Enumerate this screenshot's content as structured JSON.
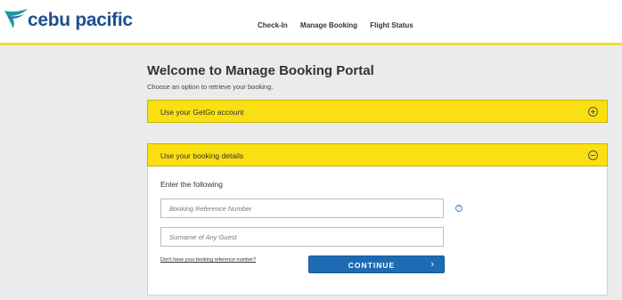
{
  "brand": {
    "name": "cebu pacific",
    "primary_color": "#1d4f8f",
    "accent_color": "#fadf12"
  },
  "nav": {
    "items": [
      "Check-In",
      "Manage Booking",
      "Flight Status"
    ]
  },
  "page": {
    "title": "Welcome to Manage Booking Portal",
    "subtitle": "Choose an option to retrieve your booking."
  },
  "panels": {
    "getgo": {
      "label": "Use your GetGo account",
      "state": "collapsed"
    },
    "booking": {
      "label": "Use your booking details",
      "state": "expanded"
    }
  },
  "form": {
    "instruction": "Enter the following",
    "booking_ref": {
      "placeholder": "Booking Reference Number",
      "value": ""
    },
    "surname": {
      "placeholder": "Surname of Any Guest",
      "value": ""
    },
    "help_icon": "question-circle-icon",
    "no_ref_link": "Don't have your booking reference number?",
    "continue_label": "CONTINUE"
  }
}
